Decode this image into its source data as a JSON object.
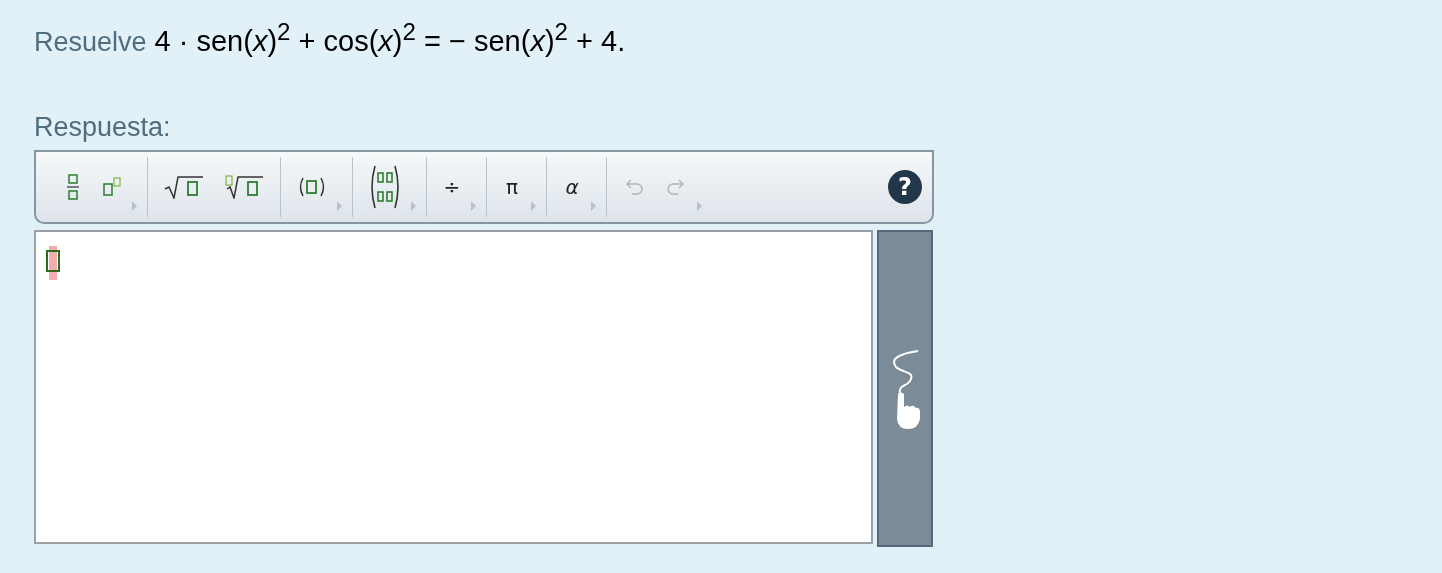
{
  "prompt": {
    "label": "Resuelve",
    "expression": "4 · sen(*x*)$^{2}$ + cos(*x*)$^{2}$ = − sen(*x*)$^{2}$ + 4."
  },
  "answer_label": "Respuesta:",
  "toolbar": {
    "groups": [
      {
        "items": [
          {
            "kind": "fraction"
          },
          {
            "kind": "superscript"
          }
        ],
        "dropdown": true
      },
      {
        "items": [
          {
            "kind": "sqrt"
          },
          {
            "kind": "nthroot"
          }
        ]
      },
      {
        "items": [
          {
            "kind": "parentheses"
          }
        ],
        "dropdown": true
      },
      {
        "items": [
          {
            "kind": "matrix"
          }
        ],
        "dropdown": true
      },
      {
        "items": [
          {
            "kind": "glyph",
            "text": "÷"
          }
        ],
        "dropdown": true
      },
      {
        "items": [
          {
            "kind": "glyph",
            "text": "π"
          }
        ],
        "dropdown": true
      },
      {
        "items": [
          {
            "kind": "glyph",
            "text": "α",
            "italic": true
          }
        ],
        "dropdown": true
      },
      {
        "items": [
          {
            "kind": "undo",
            "disabled": true
          },
          {
            "kind": "redo",
            "disabled": true
          }
        ],
        "dropdown": true
      }
    ],
    "help": "?"
  },
  "editor": {
    "cursor_placeholder": true
  }
}
